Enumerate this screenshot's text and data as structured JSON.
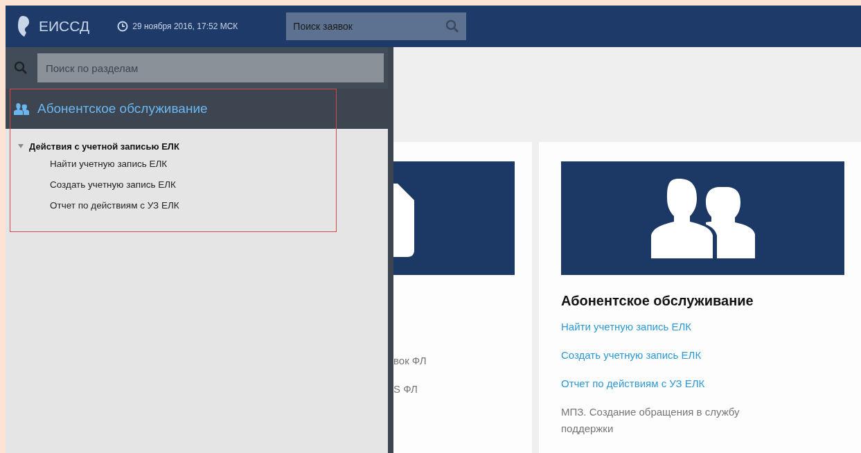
{
  "header": {
    "logo": "ЕИССД",
    "datetime": "29 ноября 2016, 17:52 МСК",
    "search": {
      "placeholder": "Поиск заявок"
    }
  },
  "sidebar": {
    "search": {
      "placeholder": "Поиск по разделам"
    },
    "section": "Абонентское обслуживание",
    "tree": [
      {
        "label": "Действия с учетной записью ЕЛК",
        "expanded": true,
        "children": [
          {
            "label": "Найти учетную запись ЕЛК"
          },
          {
            "label": "Создать учетную запись ЕЛК"
          },
          {
            "label": "Отчет по действиям с УЗ ЕЛК"
          }
        ]
      }
    ]
  },
  "cards": [
    {
      "kind": "document",
      "lines": [
        {
          "text": "вок ФЛ",
          "kind": "text"
        },
        {
          "text": "S ФЛ",
          "kind": "text"
        }
      ]
    },
    {
      "kind": "people",
      "title": "Абонентское обслуживание",
      "lines": [
        {
          "text": "Найти учетную запись ЕЛК",
          "kind": "link"
        },
        {
          "text": "Создать учетную запись ЕЛК",
          "kind": "link"
        },
        {
          "text": "Отчет по действиям с УЗ ЕЛК",
          "kind": "link"
        },
        {
          "text": "МПЗ. Создание обращения в службу поддержки",
          "kind": "text"
        }
      ]
    }
  ]
}
